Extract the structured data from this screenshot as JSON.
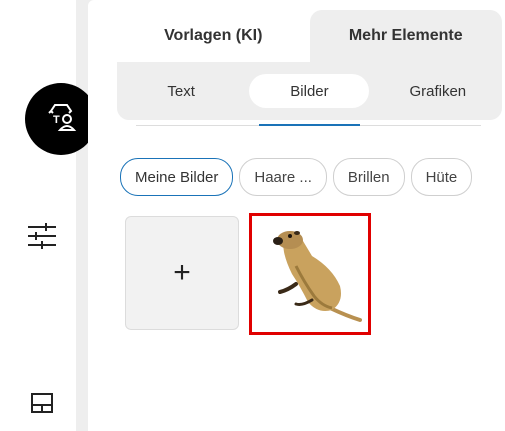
{
  "sidebar": {
    "items": [
      {
        "icon": "person-frame-icon"
      },
      {
        "icon": "text-person-swap-icon",
        "active": true
      },
      {
        "icon": "sliders-icon"
      },
      {
        "icon": "layout-icon"
      }
    ]
  },
  "tabs": [
    {
      "label": "Vorlagen (KI)",
      "active": false
    },
    {
      "label": "Mehr Elemente",
      "active": true
    }
  ],
  "subtabs": [
    {
      "label": "Text"
    },
    {
      "label": "Bilder",
      "active": true
    },
    {
      "label": "Grafiken"
    }
  ],
  "chips": [
    {
      "label": "Meine Bilder",
      "active": true
    },
    {
      "label": "Haare ..."
    },
    {
      "label": "Brillen"
    },
    {
      "label": "Hüte"
    }
  ],
  "gallery": {
    "add_label": "+",
    "images": [
      {
        "name": "meerkat",
        "selected": true
      }
    ]
  },
  "colors": {
    "accent": "#1a73b8",
    "selection": "#e00000"
  }
}
